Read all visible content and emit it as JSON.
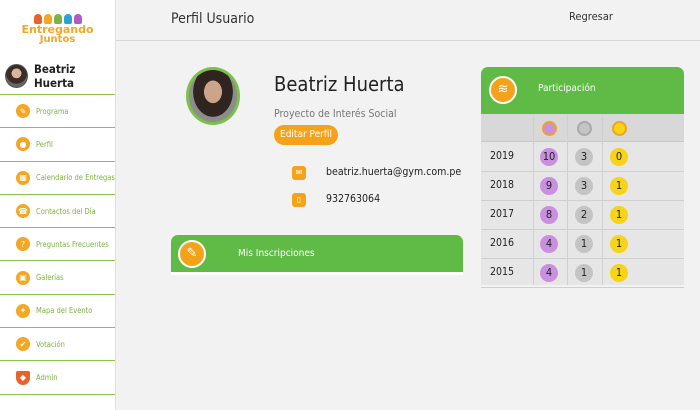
{
  "app": {
    "logo_line1": "Entregando",
    "logo_line2": "Juntos",
    "logo_colors": [
      "#e8632b",
      "#f5a623",
      "#7cb342",
      "#29a3d6",
      "#b05cc4"
    ]
  },
  "sidebar": {
    "user_name": "Beatriz Huerta",
    "items": [
      {
        "label": "Programa",
        "icon": "program-icon",
        "glyph": "✎"
      },
      {
        "label": "Perfil",
        "icon": "profile-icon",
        "glyph": "●"
      },
      {
        "label": "Calendario de Entregas",
        "icon": "calendar-icon",
        "glyph": "▦"
      },
      {
        "label": "Contactos del Día",
        "icon": "contacts-icon",
        "glyph": "☎"
      },
      {
        "label": "Preguntas Frecuentes",
        "icon": "faq-icon",
        "glyph": "?"
      },
      {
        "label": "Galerías",
        "icon": "gallery-icon",
        "glyph": "▣"
      },
      {
        "label": "Mapa del Evento",
        "icon": "map-icon",
        "glyph": "✦"
      },
      {
        "label": "Votación",
        "icon": "vote-icon",
        "glyph": "✔"
      },
      {
        "label": "Admin",
        "icon": "shield-icon",
        "glyph": "◆"
      }
    ]
  },
  "header": {
    "title": "Perfil Usuario",
    "back_label": "Regresar"
  },
  "profile": {
    "name": "Beatriz Huerta",
    "role": "Proyecto de Interés Social",
    "edit_label": "Editar Perfil",
    "email": "beatriz.huerta@gym.com.pe",
    "phone": "932763064"
  },
  "inscripciones": {
    "title": "Mis Inscripciones"
  },
  "participacion": {
    "title": "Participación",
    "column_colors": [
      "#c990e0",
      "#c4c4c4",
      "#f7d31a"
    ],
    "rows": [
      {
        "year": "2019",
        "values": [
          "10",
          "3",
          "0"
        ]
      },
      {
        "year": "2018",
        "values": [
          "9",
          "3",
          "1"
        ]
      },
      {
        "year": "2017",
        "values": [
          "8",
          "2",
          "1"
        ]
      },
      {
        "year": "2016",
        "values": [
          "4",
          "1",
          "1"
        ]
      },
      {
        "year": "2015",
        "values": [
          "4",
          "1",
          "1"
        ]
      }
    ]
  }
}
